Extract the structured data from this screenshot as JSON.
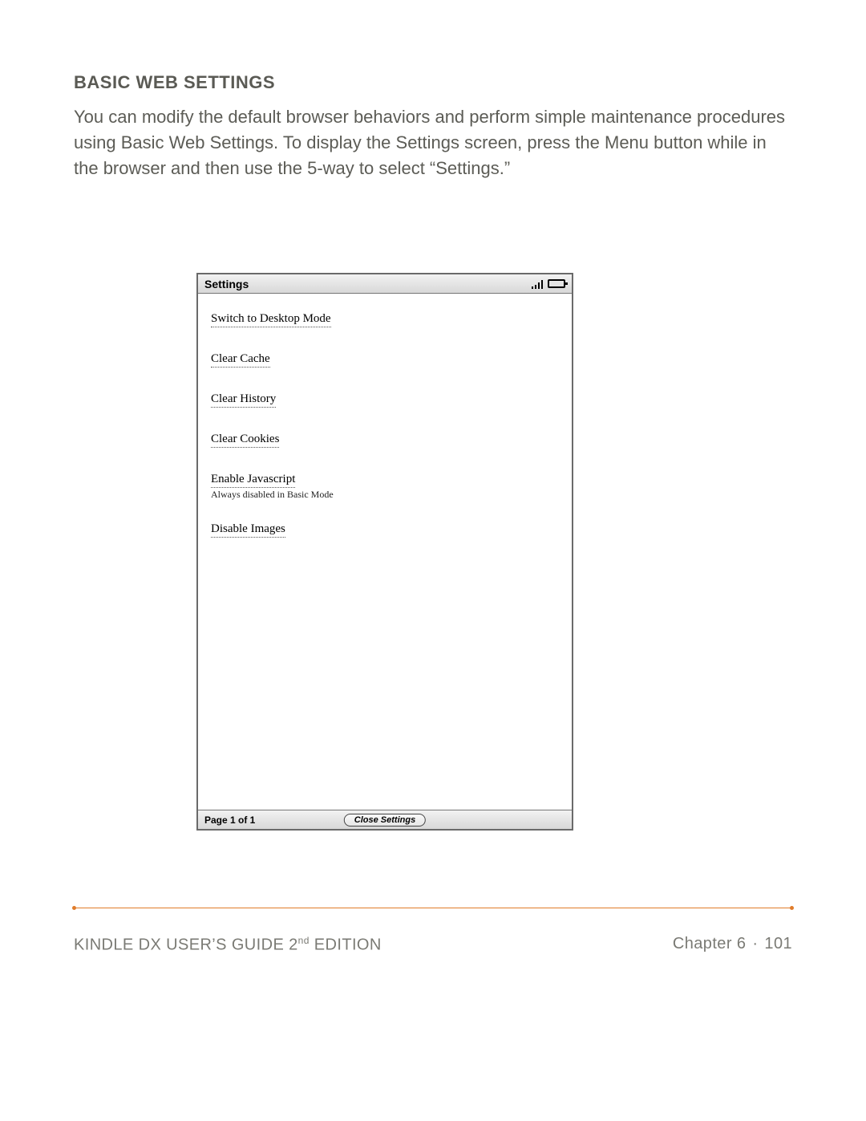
{
  "section": {
    "title": "BASIC WEB SETTINGS",
    "body": "You can modify the default browser behaviors and perform simple maintenance procedures using Basic Web Settings. To display the Settings screen, press the Menu button while in the browser and then use the 5-way to select “Settings.”"
  },
  "device": {
    "header_title": "Settings",
    "menu": {
      "switch_mode": "Switch to Desktop Mode",
      "clear_cache": "Clear Cache",
      "clear_history": "Clear History",
      "clear_cookies": "Clear Cookies",
      "enable_js": "Enable Javascript",
      "enable_js_sub": "Always disabled in Basic Mode",
      "disable_images": "Disable Images"
    },
    "footer": {
      "page_indicator": "Page 1 of 1",
      "close_label": "Close Settings"
    }
  },
  "doc_footer": {
    "guide_prefix": "KINDLE DX USER’S GUIDE 2",
    "guide_sup": "nd",
    "guide_suffix": " EDITION",
    "chapter_label": "Chapter 6",
    "separator": "·",
    "page_number": "101"
  }
}
